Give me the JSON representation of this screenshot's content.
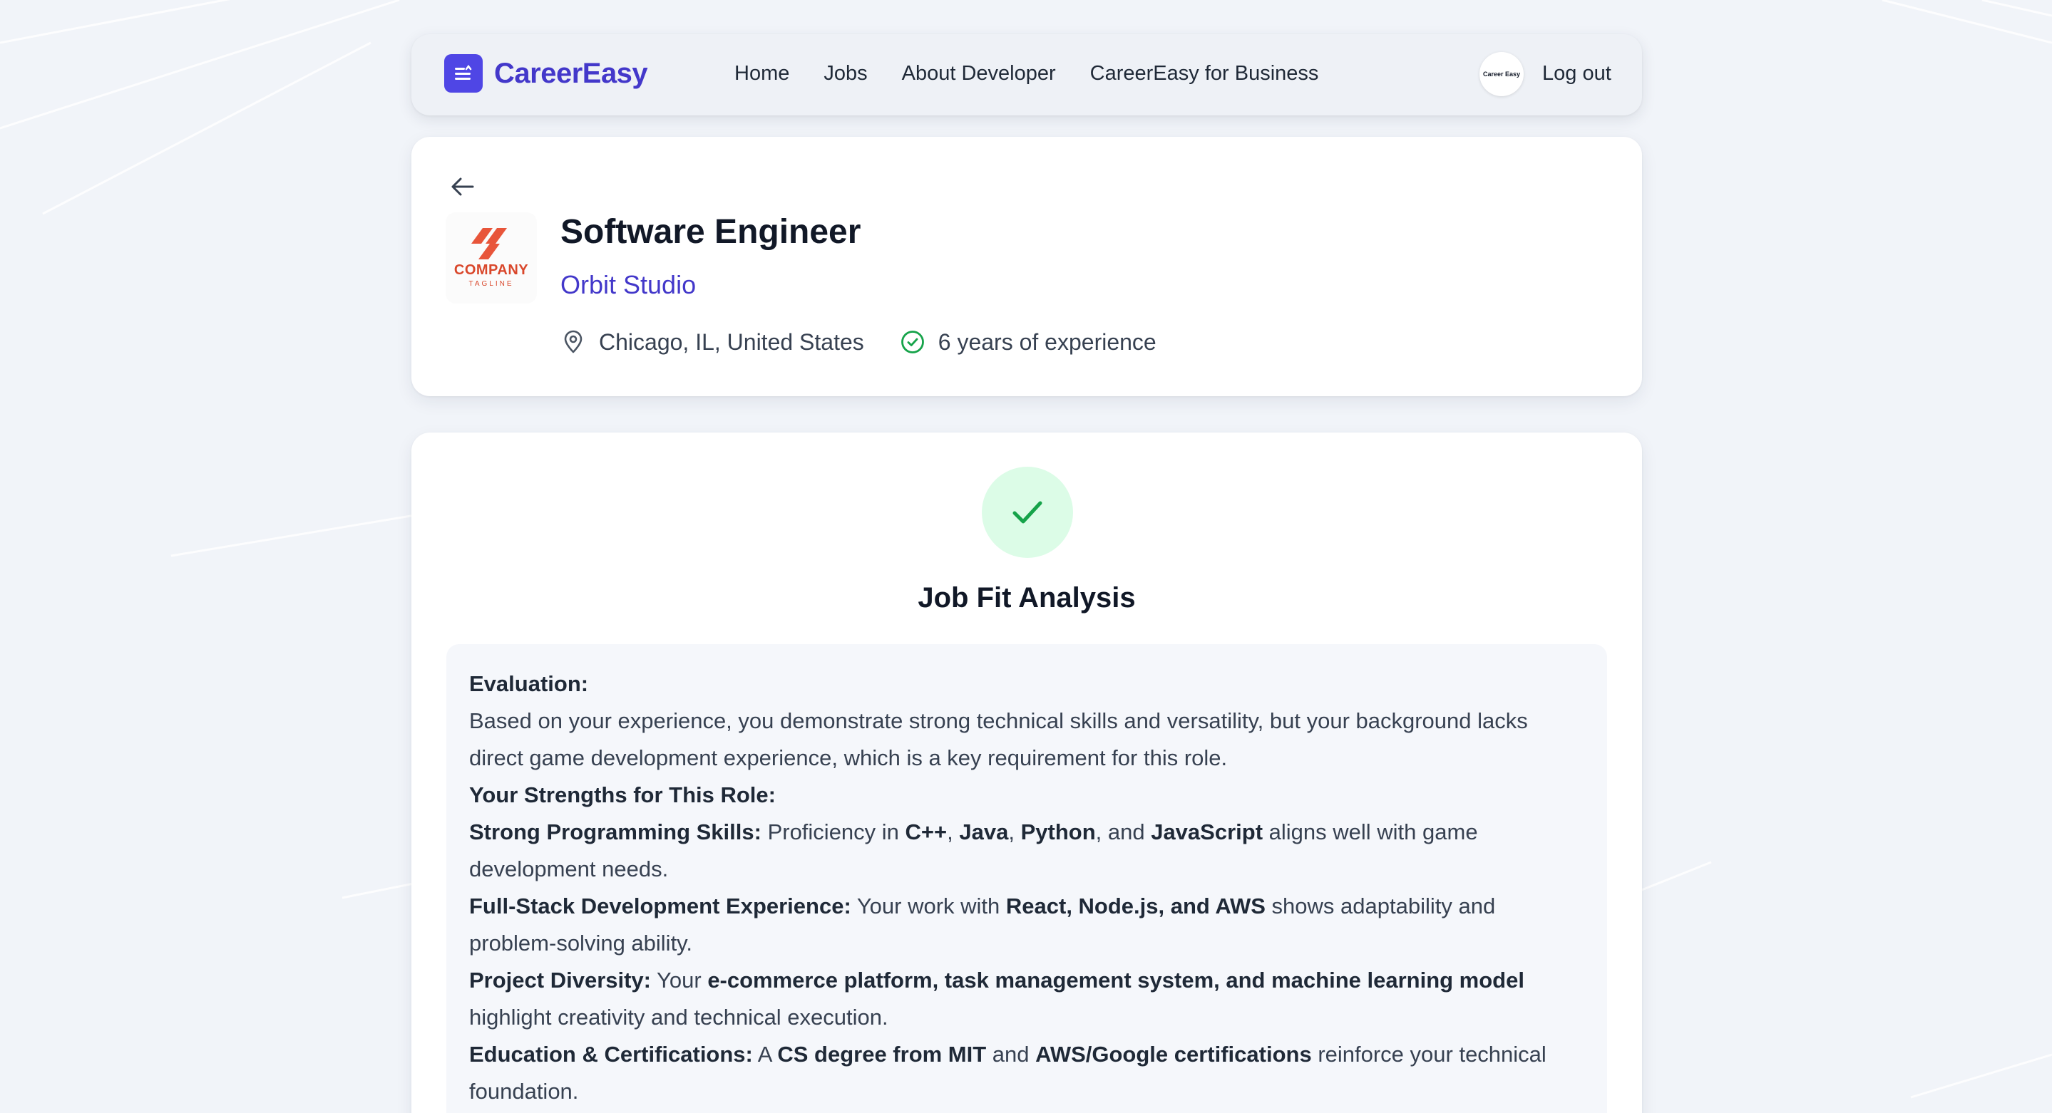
{
  "nav": {
    "brand": "CareerEasy",
    "links": [
      "Home",
      "Jobs",
      "About Developer",
      "CareerEasy for Business"
    ],
    "avatar_text": "Career Easy",
    "logout": "Log out"
  },
  "job": {
    "title": "Software Engineer",
    "company": "Orbit Studio",
    "company_logo_text": "COMPANY",
    "company_logo_tagline": "TAGLINE",
    "location": "Chicago, IL, United States",
    "experience": "6 years of experience"
  },
  "fit": {
    "title": "Job Fit Analysis",
    "evaluation_heading": "Evaluation:",
    "evaluation_text": "Based on your experience, you demonstrate strong technical skills and versatility, but your background lacks direct game development experience, which is a key requirement for this role.",
    "strengths_heading": "Your Strengths for This Role:",
    "s1_label": "Strong Programming Skills:",
    "s1_t1": " Proficiency in ",
    "s1_b1": "C++",
    "s1_t2": ", ",
    "s1_b2": "Java",
    "s1_t3": ", ",
    "s1_b3": "Python",
    "s1_t4": ", and ",
    "s1_b4": "JavaScript",
    "s1_t5": " aligns well with game development needs.",
    "s2_label": "Full-Stack Development Experience:",
    "s2_t1": " Your work with ",
    "s2_b1": "React, Node.js, and AWS",
    "s2_t2": " shows adaptability and problem-solving ability.",
    "s3_label": "Project Diversity:",
    "s3_t1": " Your ",
    "s3_b1": "e-commerce platform, task management system, and machine learning model",
    "s3_t2": " highlight creativity and technical execution.",
    "s4_label": "Education & Certifications:",
    "s4_t1": " A ",
    "s4_b1": "CS degree from MIT",
    "s4_t2": " and ",
    "s4_b2": "AWS/Google certifications",
    "s4_t3": " reinforce your technical foundation."
  },
  "colors": {
    "brand": "#4338ca",
    "brand_box": "#4f46e5",
    "success": "#16a34a",
    "success_bg": "#dcfce7",
    "logo_accent": "#e8553a"
  },
  "icons": [
    "menu-icon",
    "arrow-left-icon",
    "location-pin-icon",
    "check-circle-icon",
    "check-icon"
  ]
}
